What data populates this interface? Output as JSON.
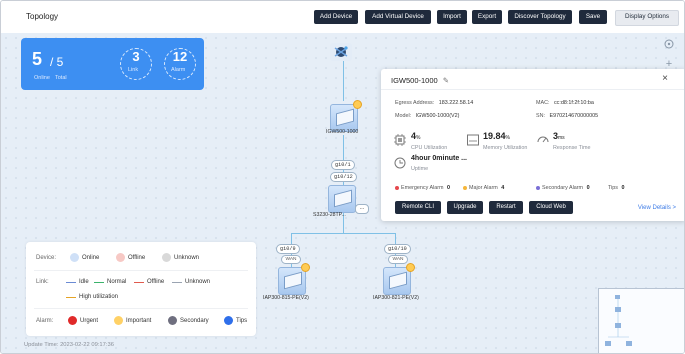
{
  "toolbar": {
    "title": "Topology",
    "buttons": [
      "Add Device",
      "Add Virtual Device",
      "Import",
      "Export",
      "Discover Topology",
      "Save"
    ],
    "display_options": "Display Options"
  },
  "summary": {
    "online": "5",
    "total": "/ 5",
    "online_label": "Online",
    "total_label": "Total",
    "link_count": "3",
    "link_label": "Link",
    "alarm_count": "12",
    "alarm_label": "Alarm"
  },
  "topology": {
    "devices": {
      "gateway": "IGW500-1000",
      "switch": "S3230-28TP...",
      "ap1": "IAP300-815-PE(V2)",
      "ap2": "IAP300-821-PE(V2)"
    },
    "ports": {
      "g1": "gi0/1",
      "g12": "gi0/12",
      "g9": "gi0/9",
      "g10": "gi0/10",
      "wan1": "WAN",
      "wan2": "WAN"
    },
    "switch_more": "..."
  },
  "legend": {
    "device_label": "Device:",
    "device_items": [
      "Online",
      "Offline",
      "Unknown"
    ],
    "link_label": "Link:",
    "link_items": [
      "Idle",
      "Normal",
      "Offline",
      "Unknown"
    ],
    "high_util": "High utilization",
    "alarm_label": "Alarm:",
    "alarm_items": [
      "Urgent",
      "Important",
      "Secondary",
      "Tips"
    ]
  },
  "update_time": "Update Time:  2023-02-22 09:17:36",
  "popup": {
    "title": "IGW500-1000",
    "edit_icon": "✎",
    "close": "×",
    "egress_label": "Egress Address:",
    "egress": "183.222.58.14",
    "mac_label": "MAC:",
    "mac": "cc:d8:1f:2f:10:ba",
    "model_label": "Model:",
    "model": "IGW500-1000(V2)",
    "sn_label": "SN:",
    "sn": "E970214670000005",
    "cpu_val": "4",
    "cpu_unit": "%",
    "cpu_label": "CPU Utilization",
    "mem_val": "19.84",
    "mem_unit": "%",
    "mem_label": "Memory Utilization",
    "resp_val": "3",
    "resp_unit": "ms",
    "resp_label": "Response Time",
    "uptime_val": "4hour 0minute ...",
    "uptime_label": "Uptime",
    "alarms": [
      {
        "label": "Emergency Alarm",
        "count": "0",
        "color": "#e5484d"
      },
      {
        "label": "Major Alarm",
        "count": "4",
        "color": "#f5b63a"
      },
      {
        "label": "Secondary Alarm",
        "count": "0",
        "color": "#7b6fd6"
      },
      {
        "label": "Tips",
        "count": "0",
        "color": ""
      }
    ],
    "buttons": [
      "Remote CLI",
      "Upgrade",
      "Restart",
      "Cloud Web"
    ],
    "details": "View Details >"
  },
  "colors": {
    "accent": "#3d8ff2",
    "dark_button": "#1f2a3c",
    "legend_online": "#cfe0f7",
    "legend_offline": "#f7c9c5",
    "legend_unknown": "#d9d9d9",
    "link_idle": "#6b8bd4",
    "link_normal": "#3bb36b",
    "link_offline": "#e05a4e",
    "link_unknown": "#9aa4b2",
    "link_high": "#e5a325",
    "alarm_urgent": "#e02a2a",
    "alarm_important": "#ffd166",
    "alarm_secondary": "#6f6f7f",
    "alarm_tips": "#2f6fea"
  }
}
